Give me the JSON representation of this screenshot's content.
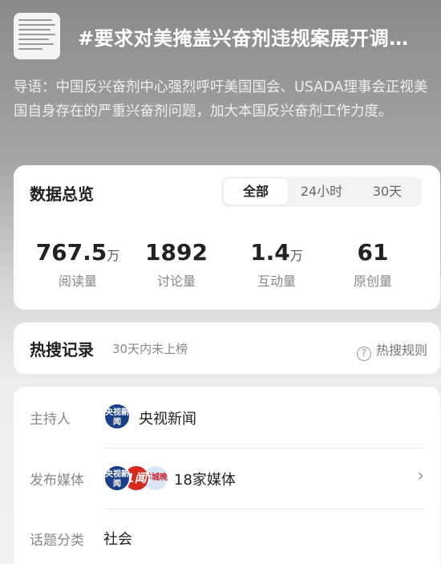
{
  "topic": {
    "thumbnail_icon": "document-thumbnail-icon",
    "title": "#要求对美掩盖兴奋剂违规案展开调…",
    "intro": "导语：中国反兴奋剂中心强烈呼吁美国国会、USADA理事会正视美国自身存在的严重兴奋剂问题，加大本国反兴奋剂工作力度。"
  },
  "overview": {
    "title": "数据总览",
    "tabs": [
      {
        "label": "全部",
        "active": true
      },
      {
        "label": "24小时",
        "active": false
      },
      {
        "label": "30天",
        "active": false
      }
    ],
    "stats": [
      {
        "value": "767.5",
        "unit": "万",
        "label": "阅读量"
      },
      {
        "value": "1892",
        "unit": "",
        "label": "讨论量"
      },
      {
        "value": "1.4",
        "unit": "万",
        "label": "互动量"
      },
      {
        "value": "61",
        "unit": "",
        "label": "原创量"
      }
    ]
  },
  "hot_search": {
    "title": "热搜记录",
    "subtitle": "30天内未上榜",
    "rules_icon": "question-circle-icon",
    "rules_label": "热搜规则"
  },
  "info": {
    "host_label": "主持人",
    "host_avatar_text": "央视新闻",
    "host_name": "央视新闻",
    "media_label": "发布媒体",
    "media_avatar_texts": [
      "央视新闻",
      "1闻",
      "羊城晚报"
    ],
    "media_count": "18家媒体",
    "media_chevron_icon": "chevron-right-icon",
    "category_label": "话题分类",
    "category_value": "社会"
  }
}
